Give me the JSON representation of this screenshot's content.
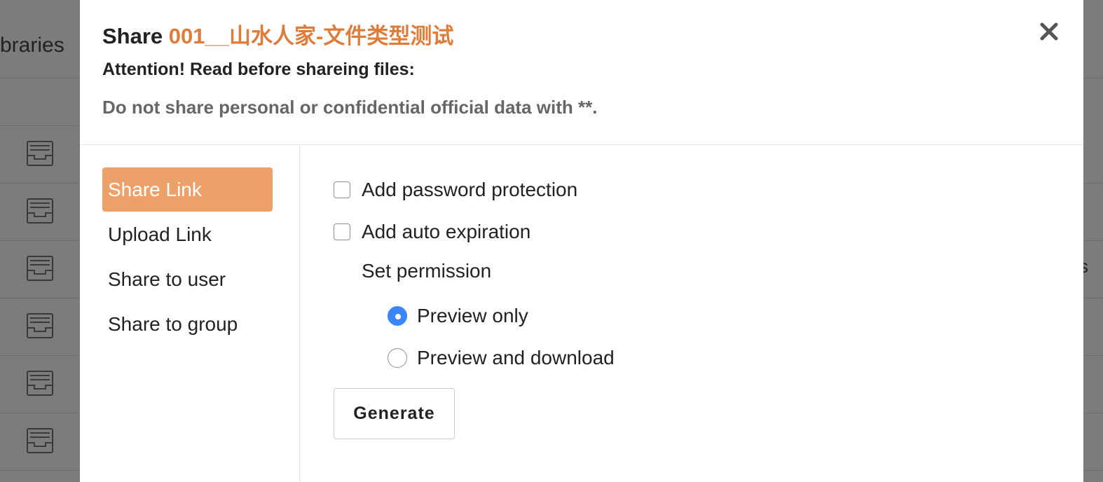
{
  "background": {
    "title_fragment": "braries",
    "right_fragment": "s",
    "row_icon": "library-inbox-icon"
  },
  "modal": {
    "title_prefix": "Share",
    "file_name": "001__山水人家-文件类型测试",
    "close_icon": "close-icon",
    "attention": "Attention! Read before shareing files:",
    "notice": "Do not share personal or confidential official data with **.",
    "nav": [
      {
        "label": "Share Link",
        "active": true
      },
      {
        "label": "Upload Link",
        "active": false
      },
      {
        "label": "Share to user",
        "active": false
      },
      {
        "label": "Share to group",
        "active": false
      }
    ],
    "options": {
      "password_label": "Add password protection",
      "expiration_label": "Add auto expiration",
      "permission_label": "Set permission",
      "preview_only_label": "Preview only",
      "preview_download_label": "Preview and download",
      "selected_permission": "Preview only"
    },
    "generate_label": "Generate"
  },
  "colors": {
    "accent_orange": "#e07c3a",
    "active_tab": "#eda16a",
    "radio_selected": "#3b86f7",
    "overlay": "#7c7c7c"
  }
}
